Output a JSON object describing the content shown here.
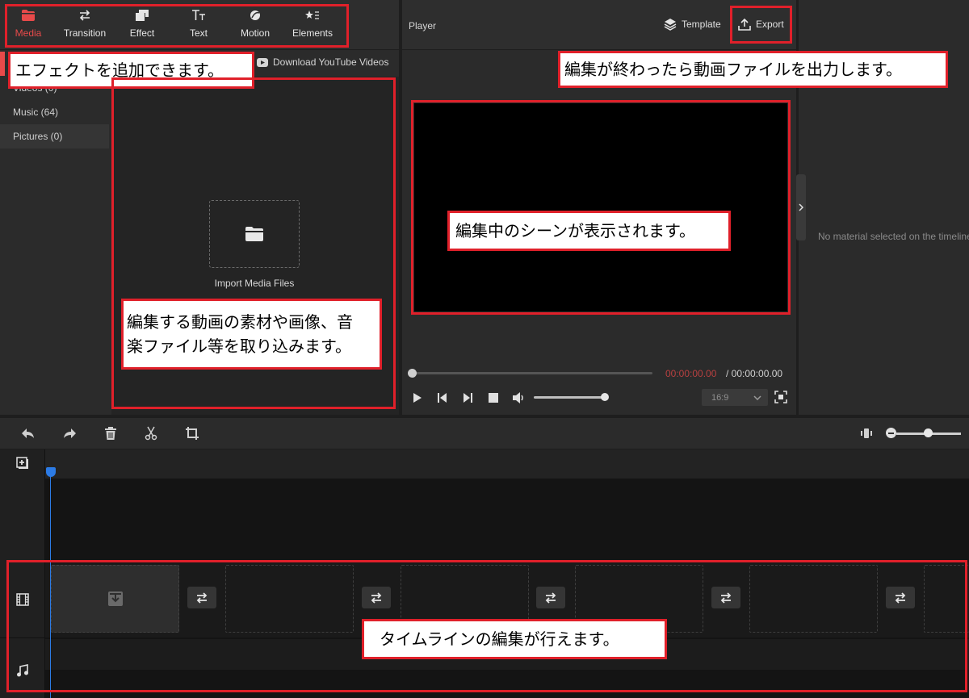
{
  "media_toolbar": {
    "tabs": [
      {
        "label": "Media",
        "icon": "folder-icon",
        "active": true
      },
      {
        "label": "Transition",
        "icon": "swap-arrows-icon"
      },
      {
        "label": "Effect",
        "icon": "layers-icon"
      },
      {
        "label": "Text",
        "icon": "text-tt-icon"
      },
      {
        "label": "Motion",
        "icon": "motion-icon"
      },
      {
        "label": "Elements",
        "icon": "elements-icon"
      }
    ]
  },
  "media_sidebar": {
    "items": [
      {
        "label": "Videos (0)"
      },
      {
        "label": "Music (64)"
      },
      {
        "label": "Pictures (0)"
      }
    ]
  },
  "media_area": {
    "download_link": "Download YouTube Videos",
    "import_label": "Import Media Files"
  },
  "player": {
    "title": "Player",
    "template_label": "Template",
    "export_label": "Export",
    "time_current": "00:00:00.00",
    "time_total": " / 00:00:00.00",
    "aspect_ratio": "16:9",
    "volume_fraction": 0.95,
    "progress_fraction": 0.0
  },
  "properties": {
    "empty_message": "No material selected on the timeline"
  },
  "timeline": {
    "zoom_fraction": 0.45,
    "clip_count": 6,
    "transition_count": 5
  },
  "annotations": {
    "effects": "エフェクトを追加できます。",
    "export": "編集が終わったら動画ファイルを出力します。",
    "scene": "編集中のシーンが表示されます。",
    "media_line1": "編集する動画の素材や画像、音",
    "media_line2": "楽ファイル等を取り込みます。",
    "timeline": "タイムラインの編集が行えます。"
  },
  "colors": {
    "accent_red": "#e84a4a",
    "annotation_red": "#e0202a",
    "playhead_blue": "#2c7be5"
  }
}
